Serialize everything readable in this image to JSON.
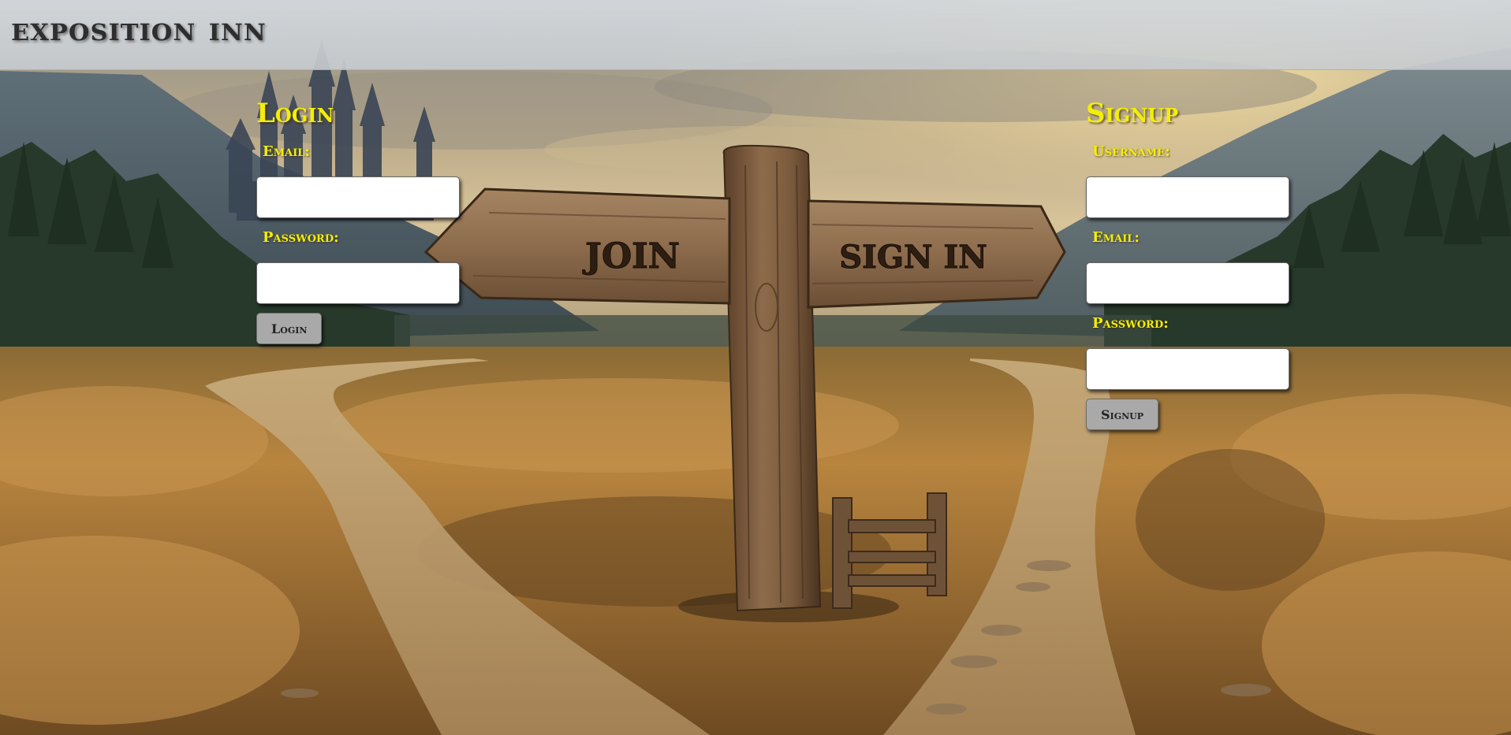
{
  "header": {
    "site_title": "exposition inn"
  },
  "signpost": {
    "left_arm_text": "JOIN",
    "right_arm_text": "SIGN IN"
  },
  "login": {
    "title": "Login",
    "email_label": "Email:",
    "password_label": "Password:",
    "email_value": "",
    "password_value": "",
    "button_label": "Login"
  },
  "signup": {
    "title": "Signup",
    "username_label": "Username:",
    "email_label": "Email:",
    "password_label": "Password:",
    "username_value": "",
    "email_value": "",
    "password_value": "",
    "button_label": "Signup"
  },
  "colors": {
    "label_yellow": "#f4ee08",
    "header_bg": "#d0d3d6",
    "button_gray": "#a9a9a9"
  }
}
